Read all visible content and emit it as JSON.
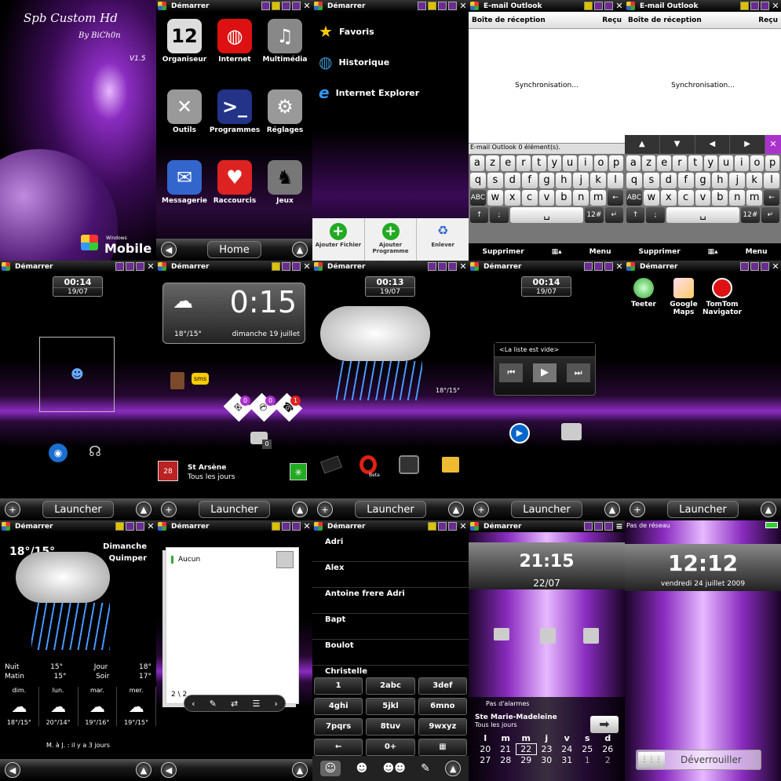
{
  "theme": {
    "accent": "#8a2cc0",
    "purple_dark": "#2a0a3a"
  },
  "splash": {
    "title": "Spb Custom Hd",
    "author": "By BiCh0n",
    "version": "V1.5",
    "brand_small": "Windows",
    "brand_big": "Mobile"
  },
  "status": {
    "start": "Démarrer",
    "email": "E-mail Outlook",
    "no_network": "Pas de réseau"
  },
  "start_menu": {
    "items": [
      {
        "label": "Organiseur",
        "icon": "calendar-icon",
        "glyph": "12"
      },
      {
        "label": "Internet",
        "icon": "globe-icon",
        "glyph": "◍"
      },
      {
        "label": "Multimédia",
        "icon": "media-icon",
        "glyph": "♫"
      },
      {
        "label": "Outils",
        "icon": "tools-icon",
        "glyph": "✕"
      },
      {
        "label": "Programmes",
        "icon": "monitor-icon",
        "glyph": ">_"
      },
      {
        "label": "Réglages",
        "icon": "gear-icon",
        "glyph": "⚙"
      },
      {
        "label": "Messagerie",
        "icon": "mail-icon",
        "glyph": "✉"
      },
      {
        "label": "Raccourcis",
        "icon": "heart-icon",
        "glyph": "♥"
      },
      {
        "label": "Jeux",
        "icon": "games-icon",
        "glyph": "♞"
      }
    ],
    "home_label": "Home"
  },
  "favorites": {
    "items": [
      "Favoris",
      "Historique",
      "Internet Explorer"
    ],
    "actions": [
      "Ajouter Fichier",
      "Ajouter Programme",
      "Enlever"
    ]
  },
  "email": {
    "inbox": "Boîte de réception",
    "received": "Reçu",
    "sync": "Synchronisation...",
    "footer": "E-mail Outlook  0 élément(s).",
    "softkeys": [
      "Supprimer",
      "Menu"
    ]
  },
  "keyboard": {
    "row1": [
      "a",
      "z",
      "e",
      "r",
      "t",
      "y",
      "u",
      "i",
      "o",
      "p"
    ],
    "row2": [
      "q",
      "s",
      "d",
      "f",
      "g",
      "h",
      "j",
      "k",
      "l"
    ],
    "row3": [
      "ABC",
      "w",
      "x",
      "c",
      "v",
      "b",
      "n",
      "m",
      "←"
    ],
    "row4": [
      "↑",
      ";",
      "␣",
      "12#",
      "↵"
    ]
  },
  "today": {
    "clock1": {
      "time": "00:14",
      "date": "19/07"
    },
    "clock2": {
      "time": "00:13",
      "date": "19/07"
    },
    "launcher": "Launcher"
  },
  "htc": {
    "time": "0:15",
    "temp": "18°/15°",
    "date": "dimanche 19 juillet",
    "sms": "sms",
    "saint": "St Arsène",
    "saint_sub": "Tous les jours",
    "badges": [
      "0",
      "0",
      "1",
      "0"
    ],
    "weather_temp": "18°/15°",
    "opera": "Beta"
  },
  "music": {
    "empty": "<La liste est vide>"
  },
  "apps": [
    {
      "label": "Teeter"
    },
    {
      "label": "Google Maps"
    },
    {
      "label": "TomTom Navigator"
    }
  ],
  "weather": {
    "temp": "18°/15°",
    "day": "Dimanche",
    "city": "Quimper",
    "rows": [
      [
        "Nuit",
        "15°",
        "Jour",
        "18°"
      ],
      [
        "Matin",
        "15°",
        "Soir",
        "17°"
      ]
    ],
    "days": [
      {
        "d": "dim.",
        "t": "18°/15°"
      },
      {
        "d": "lun.",
        "t": "20°/14°"
      },
      {
        "d": "mar.",
        "t": "19°/16°"
      },
      {
        "d": "mer.",
        "t": "19°/15°"
      }
    ],
    "updated": "M. à J. : il y a 3  jours"
  },
  "contact": {
    "name": "Aucun",
    "page": "2 \\ 2"
  },
  "contacts": {
    "names": [
      "Adri",
      "Alex",
      "Antoine frere Adri",
      "Bapt",
      "Boulot",
      "Christelle"
    ],
    "dial": [
      [
        "1",
        "2abc",
        "3def"
      ],
      [
        "4ghi",
        "5jkl",
        "6mno"
      ],
      [
        "7pqrs",
        "8tuv",
        "9wxyz"
      ],
      [
        "←",
        "0+",
        "▦"
      ]
    ]
  },
  "lock1": {
    "time": "21:15",
    "date": "22/07",
    "alarm": "Pas d'alarmes",
    "saint": "Ste Marie-Madeleine",
    "sub": "Tous les jours",
    "cal_head": [
      "l",
      "m",
      "m",
      "j",
      "v",
      "s",
      "d"
    ],
    "cal": [
      [
        "20",
        "21",
        "22",
        "23",
        "24",
        "25",
        "26"
      ],
      [
        "27",
        "28",
        "29",
        "30",
        "31",
        "1",
        "2"
      ]
    ]
  },
  "lock2": {
    "time": "12:12",
    "date": "vendredi 24 juillet 2009",
    "unlock": "Déverrouiller"
  }
}
